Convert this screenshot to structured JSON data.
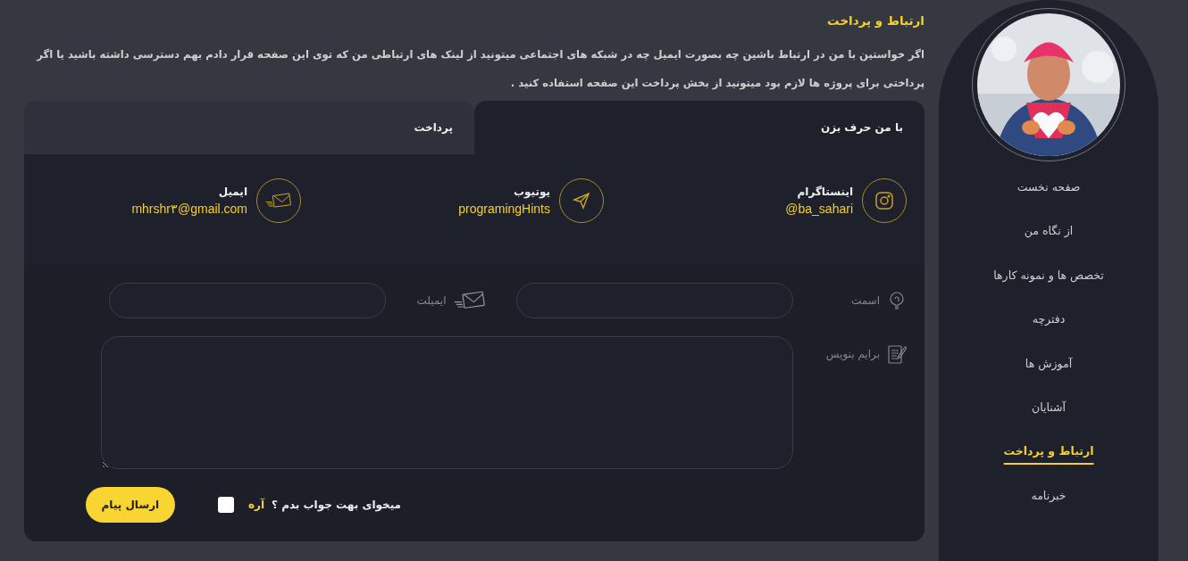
{
  "heading": "ارتباط و پرداخت",
  "intro": "اگر خواستین با من در ارتباط باشین چه بصورت ایمیل چه در شبکه های اجتماعی میتونید از لینک های ارتباطی من که توی این صفحه قرار دادم بهم دسترسی داشته باشید یا اگر پرداختی برای پروژه ها لازم بود میتونید از بخش پرداخت این صفحه استفاده کنید .",
  "tabs": [
    {
      "label": "با من حرف بزن",
      "selected": true
    },
    {
      "label": "پرداخت",
      "selected": false
    }
  ],
  "contacts": [
    {
      "kind": "instagram",
      "title": "اینستاگرام",
      "value": "@ba_sahari"
    },
    {
      "kind": "telegram",
      "title": "یوتیوب",
      "value": "programingHints"
    },
    {
      "kind": "email",
      "title": "ایمیل",
      "value": "mhrshr۳@gmail.com"
    }
  ],
  "form": {
    "fields": [
      {
        "kind": "name",
        "label": "اسمت"
      },
      {
        "kind": "email",
        "label": "ایمیلت"
      },
      {
        "kind": "message",
        "label": "برایم بنویس"
      }
    ],
    "reply_question": "میخوای بهت جواب بدم ؟",
    "reply_option": "آره",
    "reply_checked": false,
    "submit": "ارسال پیام"
  },
  "sidebar": {
    "items": [
      {
        "label": "صفحه نخست",
        "selected": false
      },
      {
        "label": "از نگاه من",
        "selected": false
      },
      {
        "label": "تخصص ها و نمونه کارها",
        "selected": false
      },
      {
        "label": "دفترچه",
        "selected": false
      },
      {
        "label": "آموزش ها",
        "selected": false
      },
      {
        "label": "آشنایان",
        "selected": false
      },
      {
        "label": "ارتباط و پرداخت",
        "selected": true
      },
      {
        "label": "خبرنامه",
        "selected": false
      }
    ]
  }
}
